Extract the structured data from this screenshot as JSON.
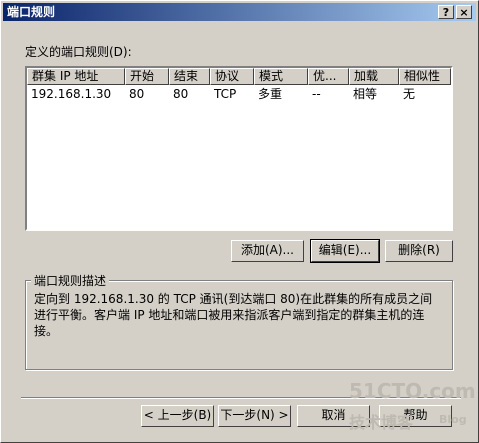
{
  "window": {
    "title": "端口规则"
  },
  "title_buttons": {
    "help": "?",
    "close": "×"
  },
  "list_label": "定义的端口规则(D):",
  "columns": [
    "群集 IP 地址",
    "开始",
    "结束",
    "协议",
    "模式",
    "优...",
    "加载",
    "相似性"
  ],
  "rows": [
    [
      "192.168.1.30",
      "80",
      "80",
      "TCP",
      "多重",
      "--",
      "相等",
      "无"
    ]
  ],
  "buttons": {
    "add": "添加(A)...",
    "edit": "编辑(E)...",
    "delete": "删除(R)"
  },
  "description": {
    "label": "端口规则描述",
    "text": "定向到 192.168.1.30 的 TCP 通讯(到达端口 80)在此群集的所有成员之间进行平衡。客户端 IP 地址和端口被用来指派客户端到指定的群集主机的连接。"
  },
  "nav": {
    "back": "< 上一步(B)",
    "next": "下一步(N) >",
    "cancel": "取消",
    "help": "帮助"
  },
  "watermark": {
    "site": "51CTO.com",
    "tagline": "技术博客",
    "blog": "Blog"
  }
}
